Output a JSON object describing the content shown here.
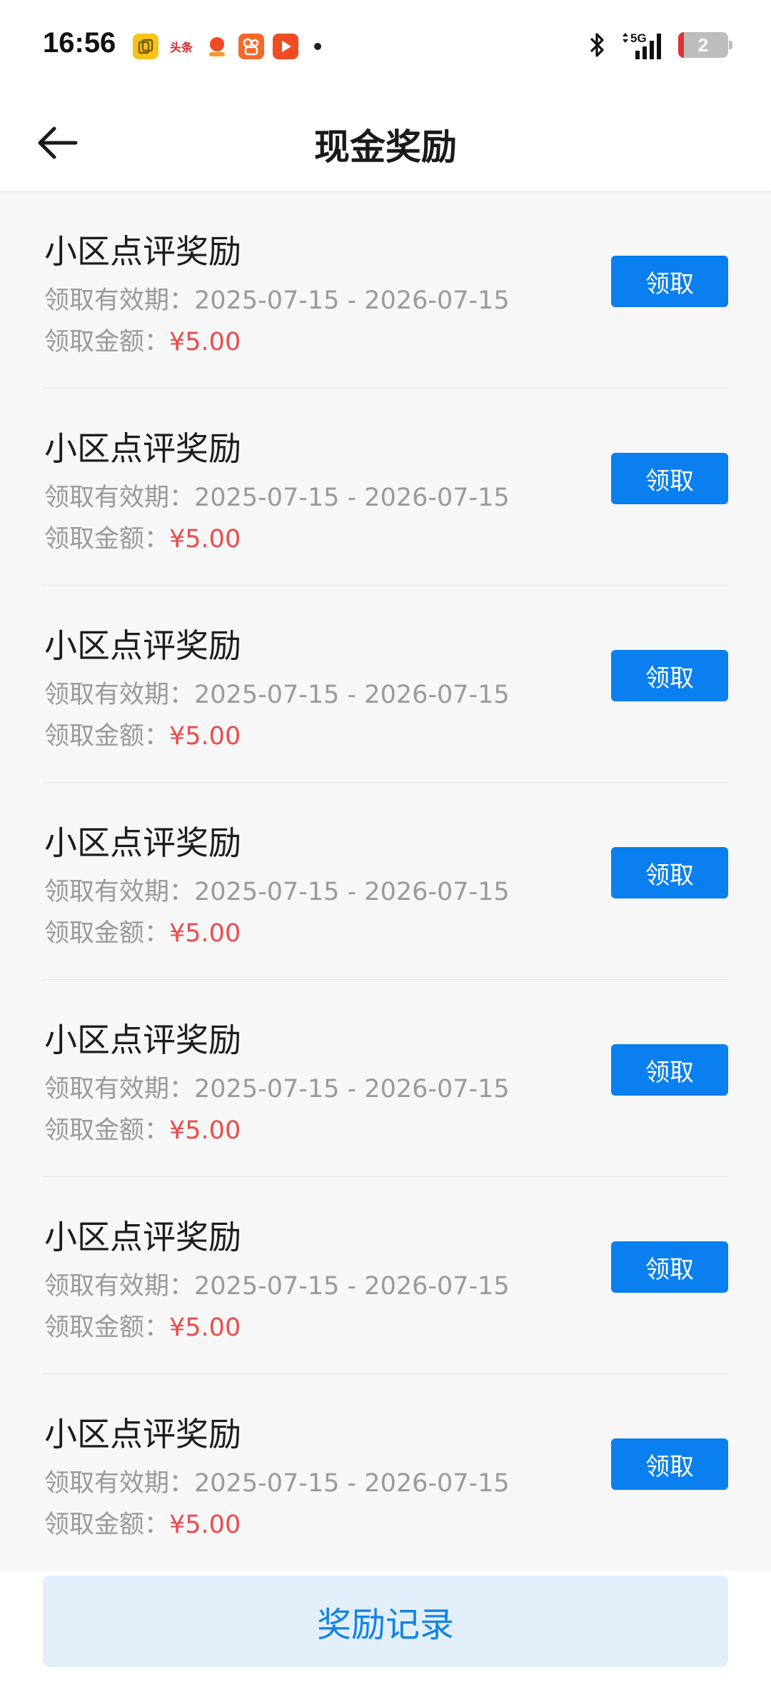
{
  "status_bar": {
    "time": "16:56",
    "notification_icons": [
      "copy-app-icon",
      "toutiao-app-icon",
      "lottery-app-icon",
      "kuaishou-app-icon",
      "video-app-icon"
    ],
    "toutiao_label": "头条",
    "network": "5G",
    "battery_level": "2"
  },
  "nav": {
    "title": "现金奖励",
    "back_icon": "arrow-left-icon"
  },
  "rewards": [
    {
      "title": "小区点评奖励",
      "validity_label": "领取有效期：",
      "validity": "2025-07-15 - 2026-07-15",
      "amount_label": "领取金额：",
      "amount": "¥5.00",
      "button": "领取"
    },
    {
      "title": "小区点评奖励",
      "validity_label": "领取有效期：",
      "validity": "2025-07-15 - 2026-07-15",
      "amount_label": "领取金额：",
      "amount": "¥5.00",
      "button": "领取"
    },
    {
      "title": "小区点评奖励",
      "validity_label": "领取有效期：",
      "validity": "2025-07-15 - 2026-07-15",
      "amount_label": "领取金额：",
      "amount": "¥5.00",
      "button": "领取"
    },
    {
      "title": "小区点评奖励",
      "validity_label": "领取有效期：",
      "validity": "2025-07-15 - 2026-07-15",
      "amount_label": "领取金额：",
      "amount": "¥5.00",
      "button": "领取"
    },
    {
      "title": "小区点评奖励",
      "validity_label": "领取有效期：",
      "validity": "2025-07-15 - 2026-07-15",
      "amount_label": "领取金额：",
      "amount": "¥5.00",
      "button": "领取"
    },
    {
      "title": "小区点评奖励",
      "validity_label": "领取有效期：",
      "validity": "2025-07-15 - 2026-07-15",
      "amount_label": "领取金额：",
      "amount": "¥5.00",
      "button": "领取"
    },
    {
      "title": "小区点评奖励",
      "validity_label": "领取有效期：",
      "validity": "2025-07-15 - 2026-07-15",
      "amount_label": "领取金额：",
      "amount": "¥5.00",
      "button": "领取"
    }
  ],
  "footer": {
    "records_label": "奖励记录"
  },
  "colors": {
    "primary_button": "#0a7ff0",
    "amount_red": "#ea4c4c",
    "records_bg": "#e2effb",
    "records_text": "#1283e4"
  }
}
